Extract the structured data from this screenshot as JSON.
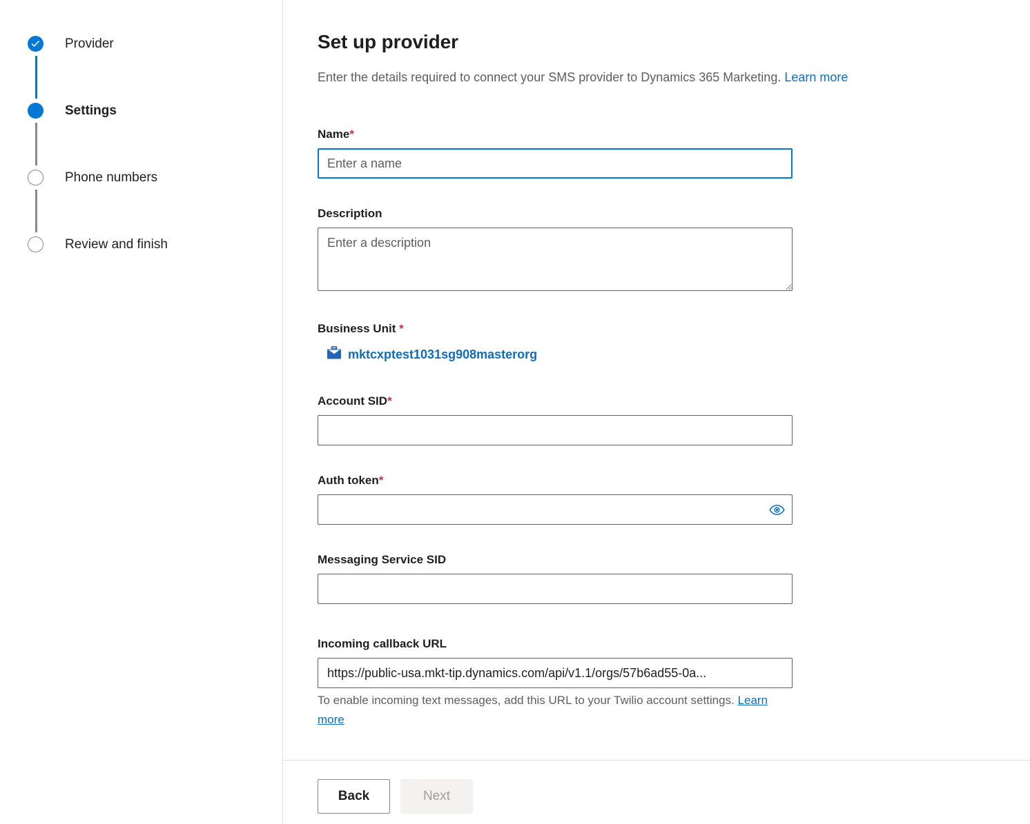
{
  "stepper": {
    "steps": [
      {
        "label": "Provider",
        "state": "completed",
        "icon": "check-circle-icon"
      },
      {
        "label": "Settings",
        "state": "current",
        "icon": "filled-circle-icon"
      },
      {
        "label": "Phone numbers",
        "state": "upcoming",
        "icon": "empty-circle-icon"
      },
      {
        "label": "Review and finish",
        "state": "upcoming",
        "icon": "empty-circle-icon"
      }
    ]
  },
  "header": {
    "title": "Set up provider",
    "subtitle": "Enter the details required to connect your SMS provider to Dynamics 365 Marketing.",
    "learn_more_label": "Learn more"
  },
  "form": {
    "name": {
      "label": "Name",
      "required_marker": "*",
      "placeholder": "Enter a name",
      "value": "",
      "focused": true
    },
    "description": {
      "label": "Description",
      "placeholder": "Enter a description",
      "value": ""
    },
    "business_unit": {
      "label": "Business Unit ",
      "required_marker": "*",
      "icon": "briefcase-icon",
      "value": "mktcxptest1031sg908masterorg"
    },
    "account_sid": {
      "label": "Account SID",
      "required_marker": "*",
      "placeholder": "",
      "value": ""
    },
    "auth_token": {
      "label": "Auth token",
      "required_marker": "*",
      "placeholder": "",
      "value": "",
      "reveal_icon": "eye-icon"
    },
    "messaging_service_sid": {
      "label": "Messaging Service SID",
      "placeholder": "",
      "value": ""
    },
    "incoming_callback_url": {
      "label": "Incoming callback URL",
      "value": "https://public-usa.mkt-tip.dynamics.com/api/v1.1/orgs/57b6ad55-0a...",
      "help_text": "To enable incoming text messages, add this URL to your Twilio account settings.",
      "help_link_label": "Learn more"
    }
  },
  "footer": {
    "back_label": "Back",
    "next_label": "Next",
    "next_disabled": true
  },
  "colors": {
    "accent": "#0078d4",
    "link": "#0f6cbd",
    "required": "#c4314b",
    "border": "#605e5c",
    "divider": "#e1dfdd",
    "muted_text": "#605e5c",
    "disabled_bg": "#f3f2f1",
    "disabled_text": "#a19f9d"
  }
}
